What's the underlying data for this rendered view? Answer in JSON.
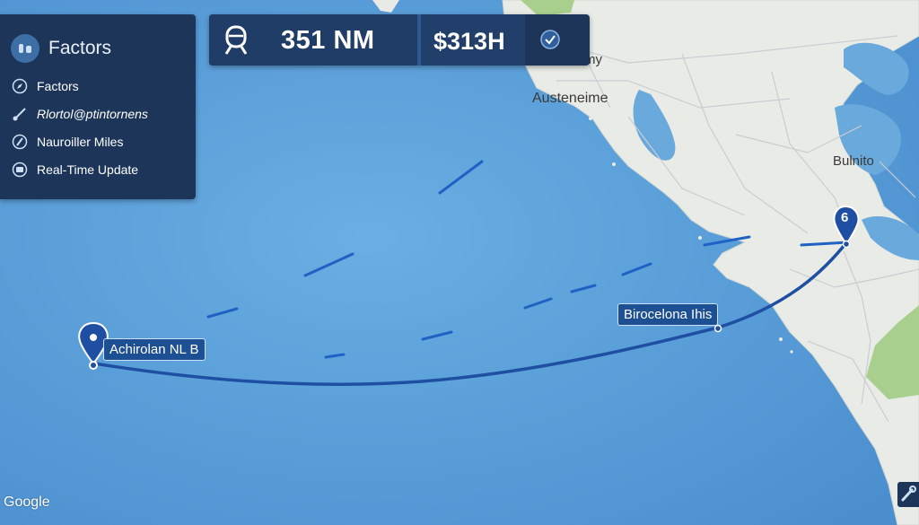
{
  "panel": {
    "title": "Factors",
    "items": [
      {
        "label": "Factors",
        "icon": "compass-icon"
      },
      {
        "label": "Rlortol@ptintornens",
        "icon": "route-icon"
      },
      {
        "label": "Nauroiller Miles",
        "icon": "navigation-icon"
      },
      {
        "label": "Real-Time Update",
        "icon": "refresh-icon"
      }
    ]
  },
  "summary": {
    "distance": "351 NM",
    "cost": "$313H",
    "transport_icon": "train-icon",
    "action_icon": "shield-check-icon"
  },
  "map": {
    "place_labels": [
      {
        "text": "my"
      },
      {
        "text": "Austeneime"
      },
      {
        "text": "Bulnito"
      }
    ],
    "origin": {
      "label": "Achirolan NL B"
    },
    "waypoint": {
      "label": "Birocelona Ihis"
    },
    "destination": {
      "label": "6"
    },
    "attribution": "Google",
    "colors": {
      "sea": "#5b9fd8",
      "land": "#e9ebe6",
      "route": "#1f4fa3",
      "park": "#a9cf8e"
    }
  }
}
